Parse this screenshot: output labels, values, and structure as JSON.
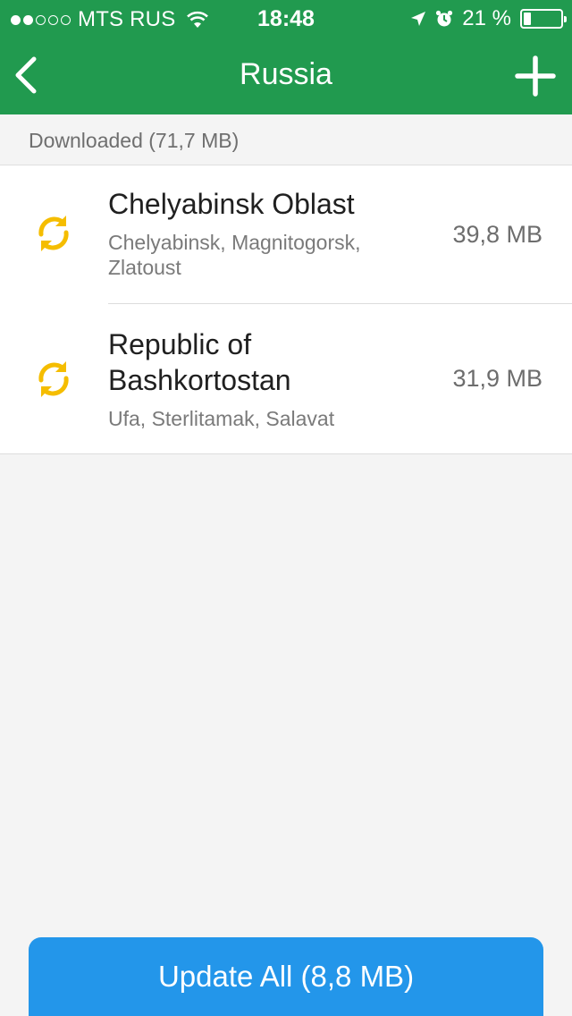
{
  "status_bar": {
    "signal_dots": [
      true,
      true,
      false,
      false,
      false
    ],
    "carrier": "MTS RUS",
    "time": "18:48",
    "battery_percent_label": "21 %",
    "battery_level": 0.21
  },
  "navbar": {
    "title": "Russia",
    "back_icon": "chevron-left-icon",
    "add_icon": "plus-icon"
  },
  "section": {
    "header": "Downloaded (71,7 MB)"
  },
  "items": [
    {
      "title": "Chelyabinsk Oblast",
      "subtitle": "Chelyabinsk, Magnitogorsk, Zlatoust",
      "size": "39,8 MB",
      "icon": "refresh-icon"
    },
    {
      "title": "Republic of Bashkortostan",
      "subtitle": "Ufa, Sterlitamak, Salavat",
      "size": "31,9 MB",
      "icon": "refresh-icon"
    }
  ],
  "footer": {
    "update_all_label": "Update All (8,8 MB)"
  },
  "colors": {
    "header_green": "#219a4f",
    "accent_yellow": "#f5bd00",
    "button_blue": "#2396ea"
  }
}
